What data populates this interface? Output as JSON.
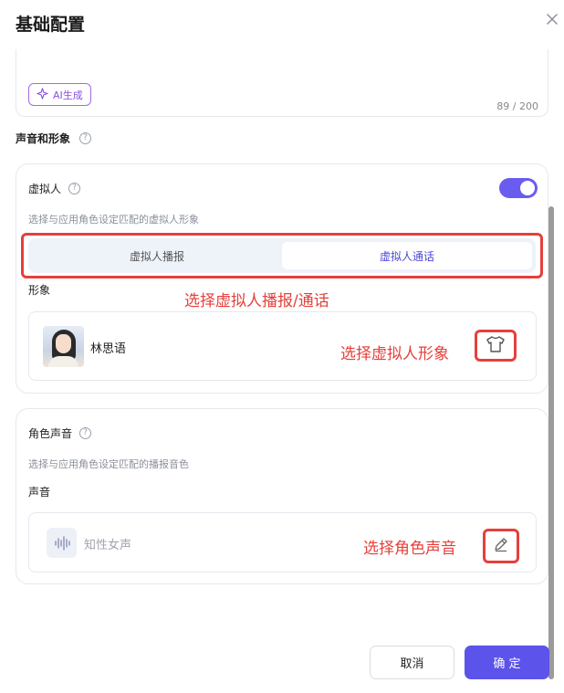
{
  "dialog": {
    "title": "基础配置"
  },
  "description": {
    "ai_button_label": "AI生成",
    "counter": "89 / 200"
  },
  "voice_and_image_section": {
    "label": "声音和形象",
    "help": "?"
  },
  "virtual_human": {
    "title": "虚拟人",
    "help": "?",
    "toggle_on": true,
    "subtitle": "选择与应用角色设定匹配的虚拟人形象",
    "tabs": [
      {
        "label": "虚拟人播报",
        "active": false
      },
      {
        "label": "虚拟人通话",
        "active": true
      }
    ],
    "appearance_label": "形象",
    "person_name": "林思语"
  },
  "role_voice": {
    "title": "角色声音",
    "help": "?",
    "subtitle": "选择与应用角色设定匹配的播报音色",
    "voice_label": "声音",
    "voice_name": "知性女声"
  },
  "annotations": {
    "tabs": "选择虚拟人播报/通话",
    "appearance": "选择虚拟人形象",
    "voice": "选择角色声音"
  },
  "buttons": {
    "cancel": "取消",
    "confirm": "确 定"
  },
  "colors": {
    "accent": "#5b53ea",
    "annotation": "#e5403b",
    "ai_purple": "#8a4fe0"
  },
  "icons": [
    "close-icon",
    "sparkle-icon",
    "help-icon",
    "shirt-icon",
    "pencil-icon",
    "waveform-icon"
  ]
}
